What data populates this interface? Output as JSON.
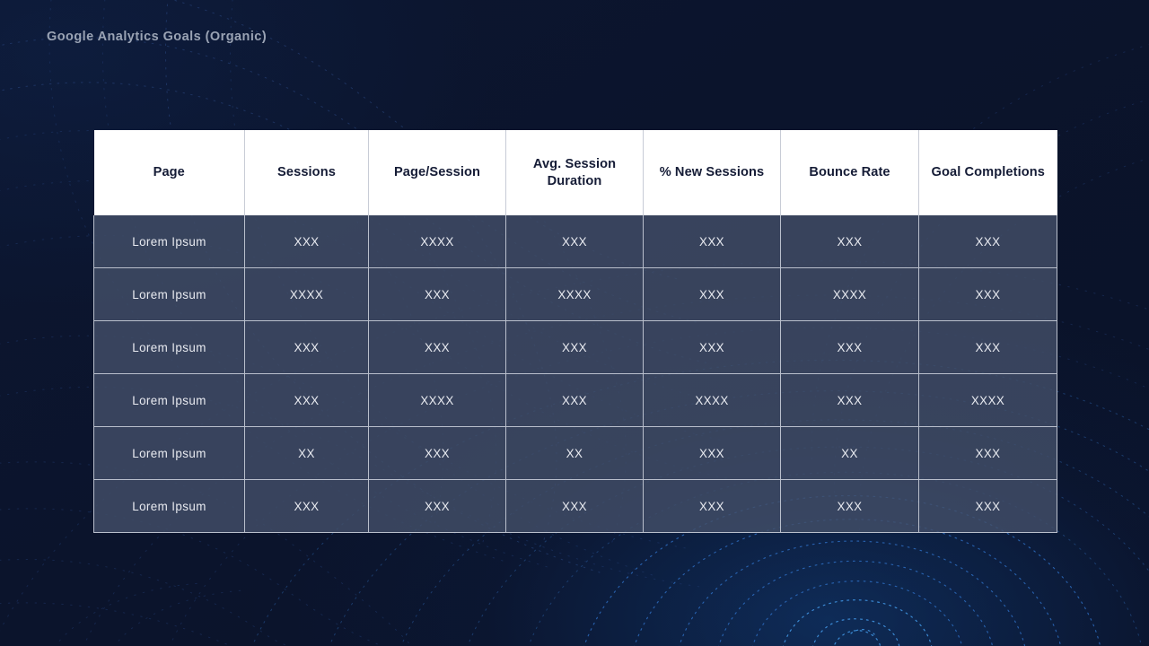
{
  "slide": {
    "title": "Google Analytics Goals (Organic)",
    "background_color": "#0a1228",
    "accent_color": "#3f93e0",
    "header_bg_color": "#ffffff",
    "header_text_color": "#151c36",
    "row_bg_color": "#424e68",
    "row_text_color": "#e8eaf0",
    "grid_line_color": "#b9bfcc"
  },
  "table": {
    "columns": [
      {
        "label": "Page"
      },
      {
        "label": "Sessions"
      },
      {
        "label": "Page/Session"
      },
      {
        "label": "Avg. Session Duration"
      },
      {
        "label": "% New Sessions"
      },
      {
        "label": "Bounce Rate"
      },
      {
        "label": "Goal Completions"
      }
    ],
    "rows": [
      {
        "cells": [
          "Lorem Ipsum",
          "XXX",
          "XXXX",
          "XXX",
          "XXX",
          "XXX",
          "XXX"
        ]
      },
      {
        "cells": [
          "Lorem Ipsum",
          "XXXX",
          "XXX",
          "XXXX",
          "XXX",
          "XXXX",
          "XXX"
        ]
      },
      {
        "cells": [
          "Lorem Ipsum",
          "XXX",
          "XXX",
          "XXX",
          "XXX",
          "XXX",
          "XXX"
        ]
      },
      {
        "cells": [
          "Lorem Ipsum",
          "XXX",
          "XXXX",
          "XXX",
          "XXXX",
          "XXX",
          "XXXX"
        ]
      },
      {
        "cells": [
          "Lorem Ipsum",
          "XX",
          "XXX",
          "XX",
          "XXX",
          "XX",
          "XXX"
        ]
      },
      {
        "cells": [
          "Lorem Ipsum",
          "XXX",
          "XXX",
          "XXX",
          "XXX",
          "XXX",
          "XXX"
        ]
      }
    ]
  }
}
